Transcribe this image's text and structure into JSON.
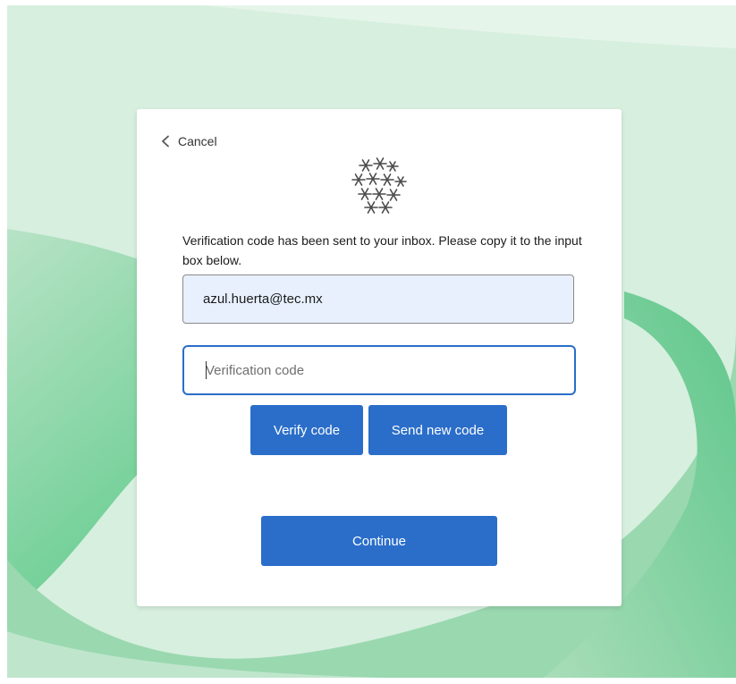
{
  "cancel": {
    "label": "Cancel",
    "icon": "chevron-left-icon"
  },
  "logo": {
    "icon": "snowflake-logo-icon"
  },
  "message": "Verification code has been sent to your inbox. Please copy it to the input box below.",
  "email_field": {
    "value": "azul.huerta@tec.mx"
  },
  "code_field": {
    "placeholder": "Verification code",
    "value": ""
  },
  "buttons": {
    "verify": "Verify code",
    "send_new": "Send new code",
    "continue": "Continue"
  },
  "colors": {
    "accent": "#2a6ec9",
    "background": "#d4eedd",
    "card": "#ffffff"
  }
}
